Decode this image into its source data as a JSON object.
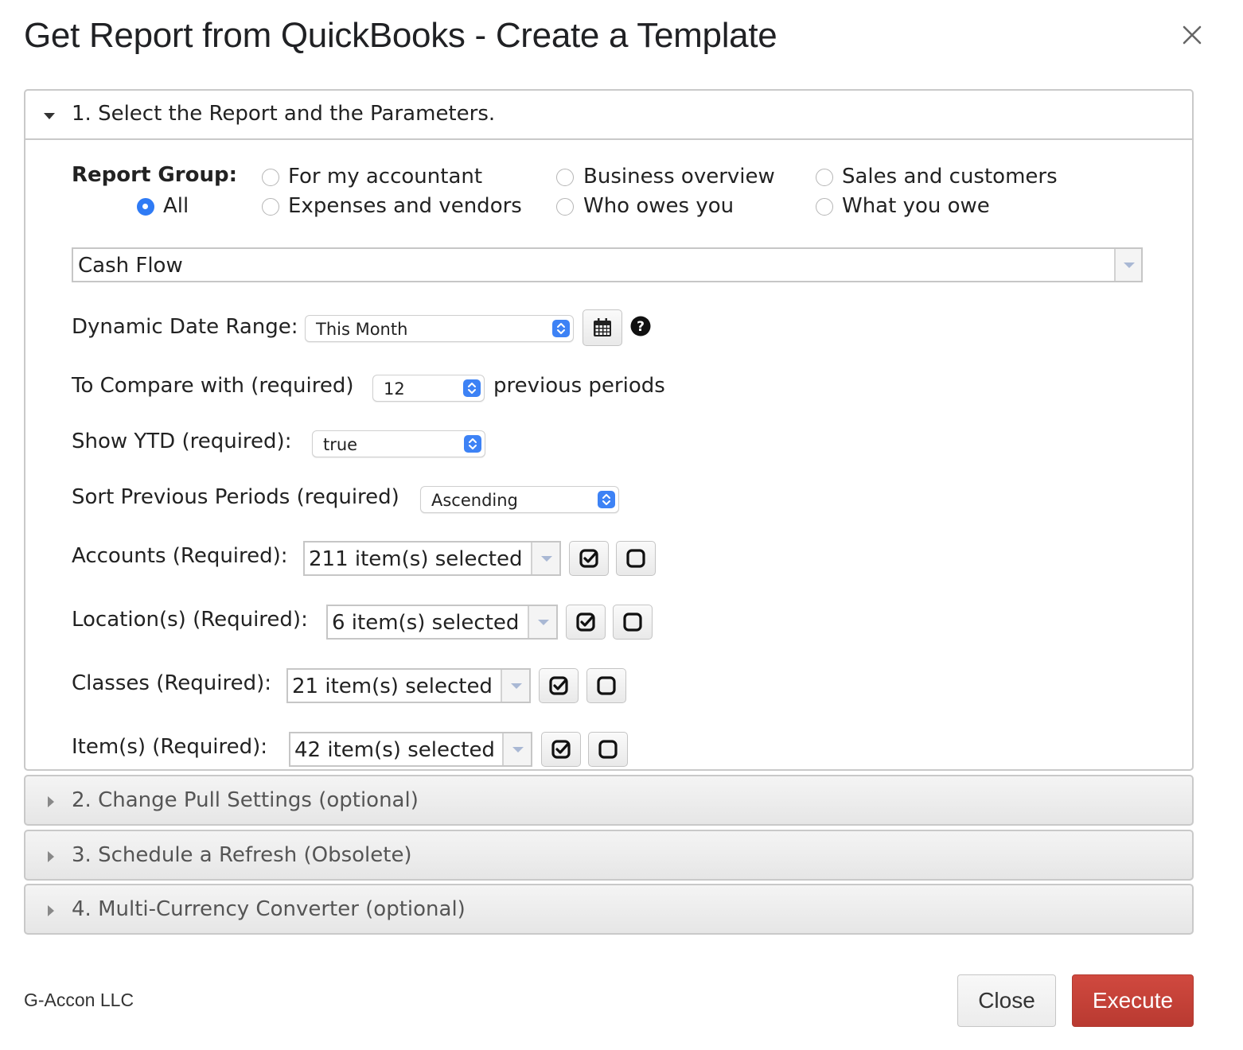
{
  "dialog": {
    "title": "Get Report from QuickBooks - Create a Template",
    "close_icon": "close-icon"
  },
  "section1": {
    "title": "1. Select the Report and the Parameters.",
    "report_group": {
      "label": "Report Group:",
      "options": [
        {
          "label": "All",
          "checked": true
        },
        {
          "label": "For my accountant",
          "checked": false
        },
        {
          "label": "Business overview",
          "checked": false
        },
        {
          "label": "Sales and customers",
          "checked": false
        },
        {
          "label": "Expenses and vendors",
          "checked": false
        },
        {
          "label": "Who owes you",
          "checked": false
        },
        {
          "label": "What you owe",
          "checked": false
        }
      ]
    },
    "report_select": {
      "value": "Cash Flow"
    },
    "date_range": {
      "label": "Dynamic Date Range:",
      "value": "This Month",
      "calendar_icon": "calendar-icon",
      "help_icon": "help-icon"
    },
    "compare": {
      "label": "To Compare with (required)",
      "value": "12",
      "suffix": "previous periods"
    },
    "ytd": {
      "label": "Show YTD (required):",
      "value": "true"
    },
    "sort": {
      "label": "Sort Previous Periods (required)",
      "value": "Ascending"
    },
    "accounts": {
      "label": "Accounts (Required):",
      "value": "211 item(s) selected"
    },
    "locations": {
      "label": "Location(s) (Required):",
      "value": "6 item(s) selected"
    },
    "classes": {
      "label": "Classes (Required):",
      "value": "21 item(s) selected"
    },
    "items": {
      "label": "Item(s) (Required):",
      "value": "42 item(s) selected"
    }
  },
  "section2": {
    "title": "2. Change Pull Settings (optional)"
  },
  "section3": {
    "title": "3. Schedule a Refresh (Obsolete)"
  },
  "section4": {
    "title": "4. Multi-Currency Converter (optional)"
  },
  "footer": {
    "company": "G-Accon LLC",
    "close_label": "Close",
    "execute_label": "Execute"
  },
  "colors": {
    "accent": "#2f7bf5",
    "execute": "#c0413a"
  }
}
